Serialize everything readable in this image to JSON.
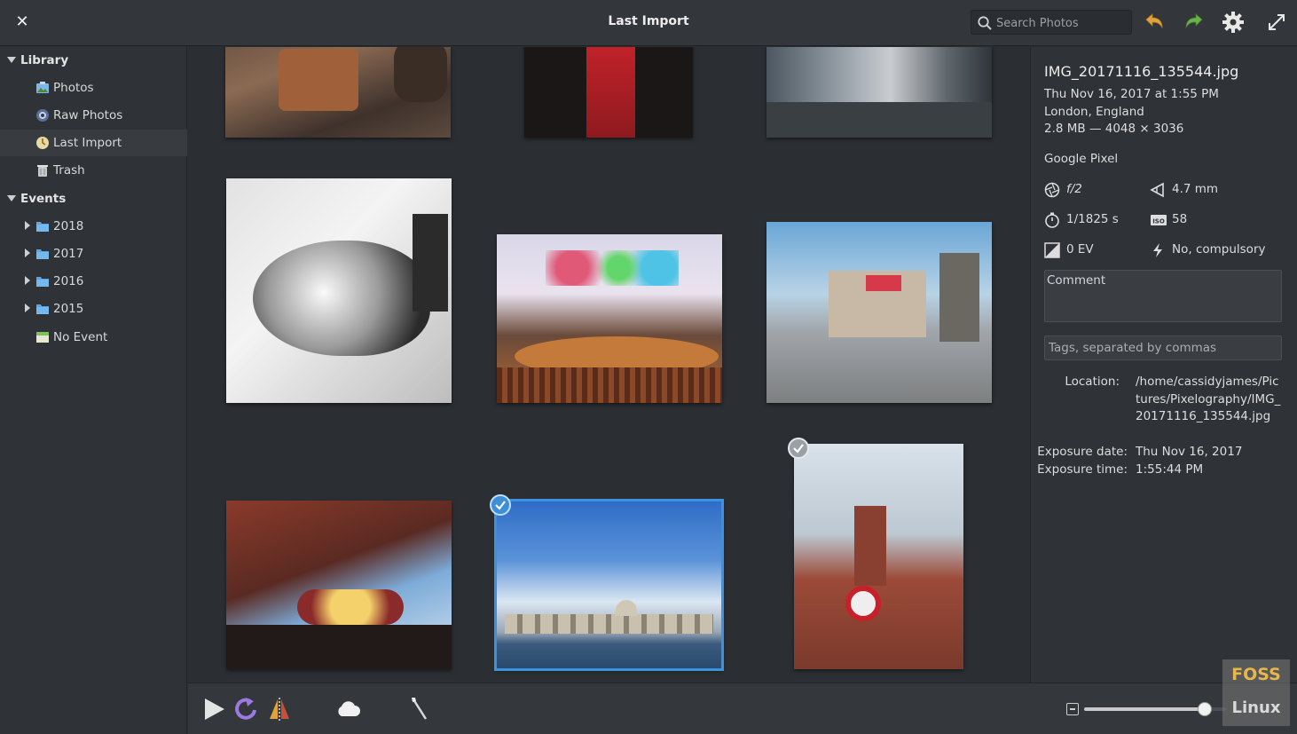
{
  "header": {
    "title": "Last Import",
    "search_placeholder": "Search Photos"
  },
  "sidebar": {
    "library_label": "Library",
    "library_items": [
      {
        "label": "Photos",
        "icon": "photos-icon"
      },
      {
        "label": "Raw Photos",
        "icon": "raw-photos-icon"
      },
      {
        "label": "Last Import",
        "icon": "last-import-icon",
        "selected": true
      },
      {
        "label": "Trash",
        "icon": "trash-icon"
      }
    ],
    "events_label": "Events",
    "event_items": [
      {
        "label": "2018",
        "icon": "folder-icon"
      },
      {
        "label": "2017",
        "icon": "folder-icon"
      },
      {
        "label": "2016",
        "icon": "folder-icon"
      },
      {
        "label": "2015",
        "icon": "folder-icon"
      },
      {
        "label": "No Event",
        "icon": "no-event-icon"
      }
    ]
  },
  "photos": [
    {
      "name": "barrel-chair-photo",
      "selected": false,
      "checked": false
    },
    {
      "name": "red-scarf-photo",
      "selected": false,
      "checked": false
    },
    {
      "name": "street-storefront-photo",
      "selected": false,
      "checked": false
    },
    {
      "name": "sleeping-cat-photo",
      "selected": false,
      "checked": false
    },
    {
      "name": "church-stage-photo",
      "selected": false,
      "checked": false
    },
    {
      "name": "city-square-photo",
      "selected": false,
      "checked": false
    },
    {
      "name": "theatre-building-photo",
      "selected": false,
      "checked": false
    },
    {
      "name": "river-skyline-photo",
      "selected": true,
      "checked": true
    },
    {
      "name": "station-tower-photo",
      "selected": false,
      "checked": false
    }
  ],
  "info": {
    "filename": "IMG_20171116_135544.jpg",
    "datetime": "Thu Nov 16, 2017 at 1:55 PM",
    "place": "London, England",
    "size": "2.8 MB — 4048 × 3036",
    "camera": "Google Pixel",
    "aperture": "f/2",
    "focal_length": "4.7 mm",
    "shutter": "1/1825 s",
    "iso": "58",
    "exposure_bias": "0 EV",
    "flash": "No, compulsory",
    "comment_label": "Comment",
    "tags_placeholder": "Tags, separated by commas",
    "location_key": "Location:",
    "location_val": "/home/cassidyjames/Pictures/Pixelography/IMG_20171116_135544.jpg",
    "exposure_date_key": "Exposure date:",
    "exposure_date_val": "Thu Nov 16, 2017",
    "exposure_time_key": "Exposure time:",
    "exposure_time_val": "1:55:44 PM"
  },
  "zoom": {
    "level": 0.85
  },
  "watermark": {
    "top": "FOSS",
    "bottom": "Linux"
  },
  "colors": {
    "accent": "#3d92e0",
    "undo": "#e0a43a",
    "redo": "#6bb24a"
  }
}
